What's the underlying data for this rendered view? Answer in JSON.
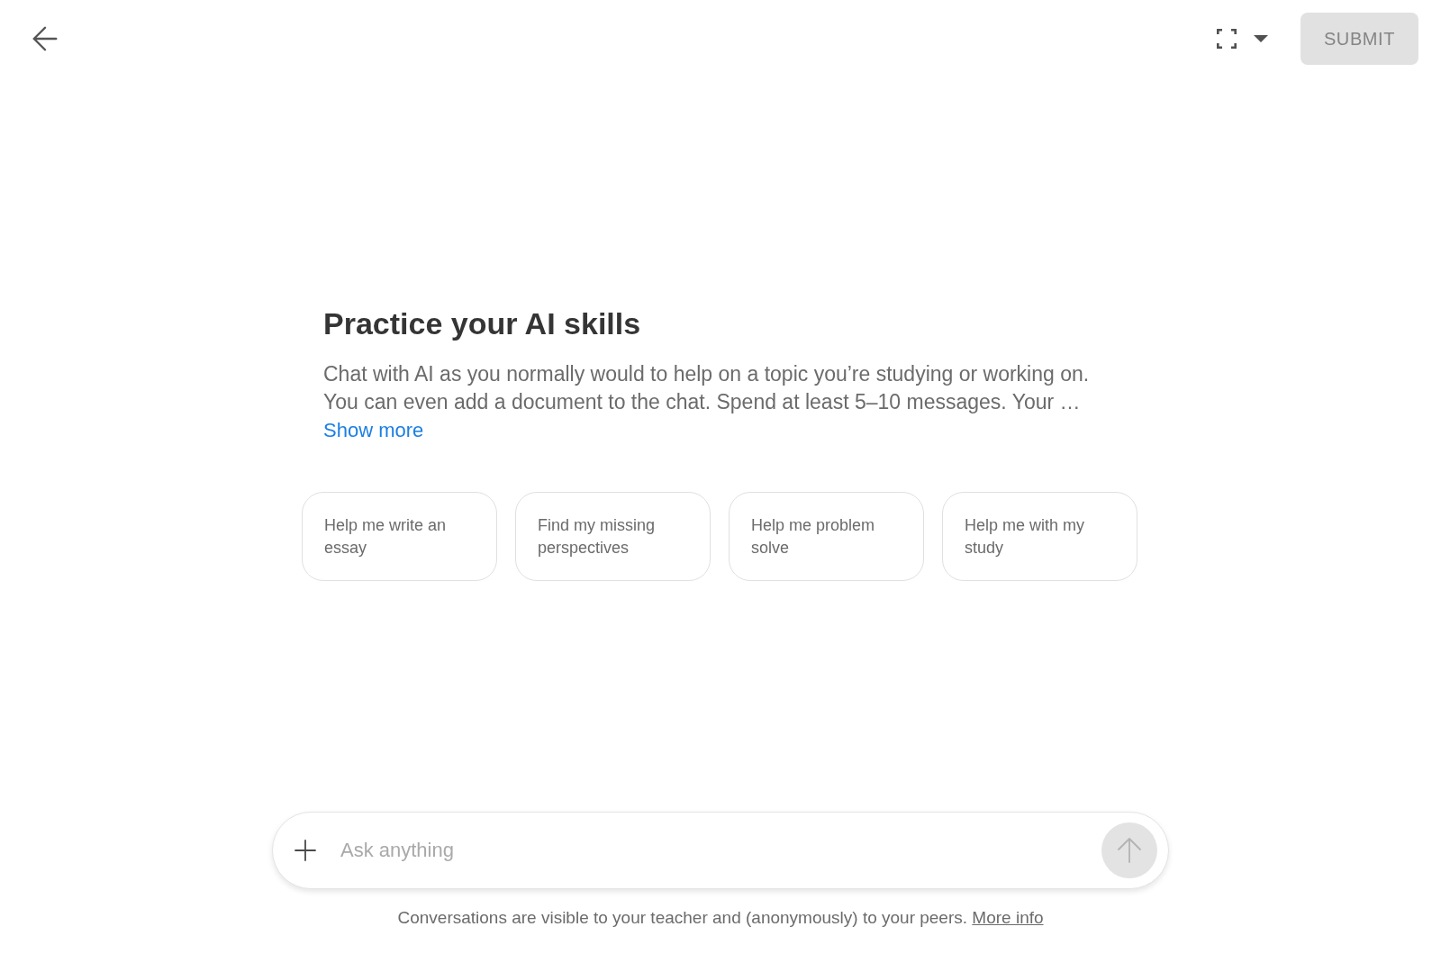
{
  "header": {
    "submit_button": {
      "label": "SUBMIT",
      "disabled": true
    }
  },
  "intro": {
    "title": "Practice your AI skills",
    "description": "Chat with AI as you normally would to help on a topic you’re studying or working on. You can even add a document to the chat. Spend at least 5–10 messages. Your …",
    "show_more_link": "Show more"
  },
  "suggestions": [
    {
      "label": "Help me write an essay"
    },
    {
      "label": "Find my missing perspectives"
    },
    {
      "label": "Help me problem solve"
    },
    {
      "label": "Help me with my study"
    }
  ],
  "composer": {
    "placeholder": "Ask anything",
    "send_button": {
      "disabled": true
    }
  },
  "footer": {
    "notice": "Conversations are visible to your teacher and (anonymously) to your peers.",
    "link": "More info"
  }
}
